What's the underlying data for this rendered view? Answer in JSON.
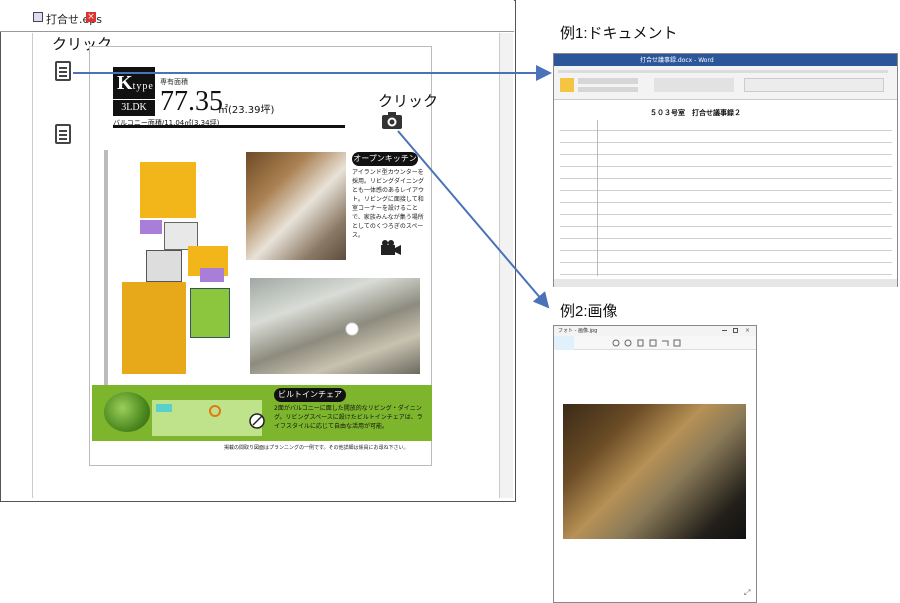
{
  "viewer": {
    "tab_title": "打合せ.eps",
    "tab_close": "×"
  },
  "annotations": {
    "click_doc": "クリック",
    "click_camera": "クリック"
  },
  "sheet": {
    "type_letter": "K",
    "type_word": "type",
    "ldk": "3LDK",
    "area_label": "専有面積",
    "area_value": "77.35",
    "area_unit": "㎡(23.39坪)",
    "balcony": "バルコニー面積/11.04㎡(3.34坪)",
    "open_kitchen_title": "オープンキッチン",
    "open_kitchen_desc": "アイランド型カウンターを採用。リビングダイニングとも一体感のあるレイアウト。リビングに面接して和室コーナーを設けることで、家族みんなが集う場所としてのくつろぎのスペース。",
    "built_in_title": "ビルトインチェア",
    "built_in_desc": "2面がバルコニーに面した開放的なリビング・ダイニング。リビングスペースに設けたビルトインチェアは、ライフスタイルに応じて自由な活用が可能。",
    "footnote": "掲載の間取り図面はプランニングの一例です。その他詳細は係員にお尋ね下さい。"
  },
  "examples": {
    "ex1_title": "例1:ドキュメント",
    "ex1_doc_title": "５０３号室　打合せ議事録２",
    "ex1_window_title": "打合せ議事録.docx - Word",
    "ex2_title": "例2:画像",
    "ex2_window_title": "フォト - 画像.jpg"
  },
  "icons": {
    "doc_icon": "document-icon",
    "camera_icon": "camera-icon",
    "video_icon": "video-camera-icon",
    "compass_icon": "compass-icon"
  },
  "colors": {
    "arrow": "#4a72b8",
    "green_band": "#7db52c",
    "word_blue": "#2b579a"
  }
}
